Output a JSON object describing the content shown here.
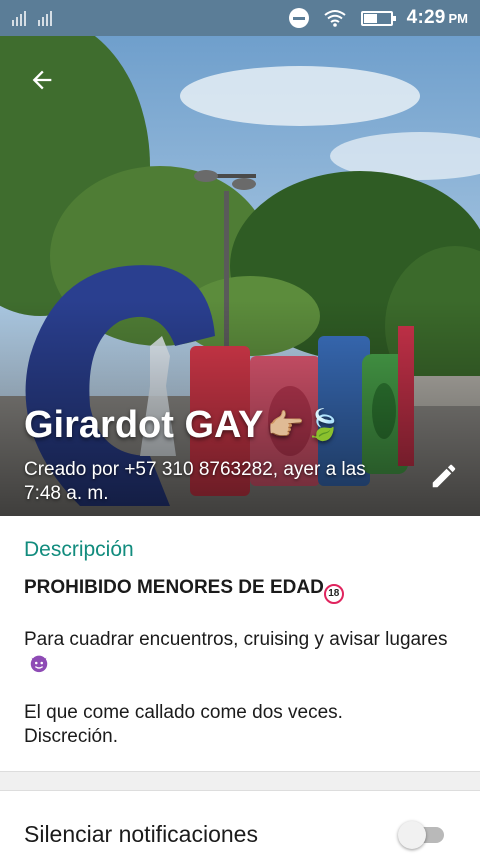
{
  "status_bar": {
    "time": "4:29",
    "ampm": "PM",
    "battery_level": 0.5
  },
  "header": {
    "back_icon": "arrow-back-icon",
    "group_name": "Girardot GAY",
    "group_emojis": "👉🏼🍃",
    "created_by": "Creado por +57 310 8763282, ayer a las 7:48 a. m.",
    "edit_icon": "pencil-icon"
  },
  "description": {
    "heading": "Descripción",
    "lines": [
      "PROHIBIDO MENORES DE EDAD",
      "",
      "Para cuadrar encuentros, cruising y avisar lugares",
      "",
      "El que come callado come dos veces.",
      "Discreción."
    ],
    "prohibit_icon_text": "18"
  },
  "notifications": {
    "mute_label": "Silenciar notificaciones",
    "mute_enabled": false
  },
  "colors": {
    "status_bar": "#5b7d97",
    "accent": "#128C7E"
  }
}
